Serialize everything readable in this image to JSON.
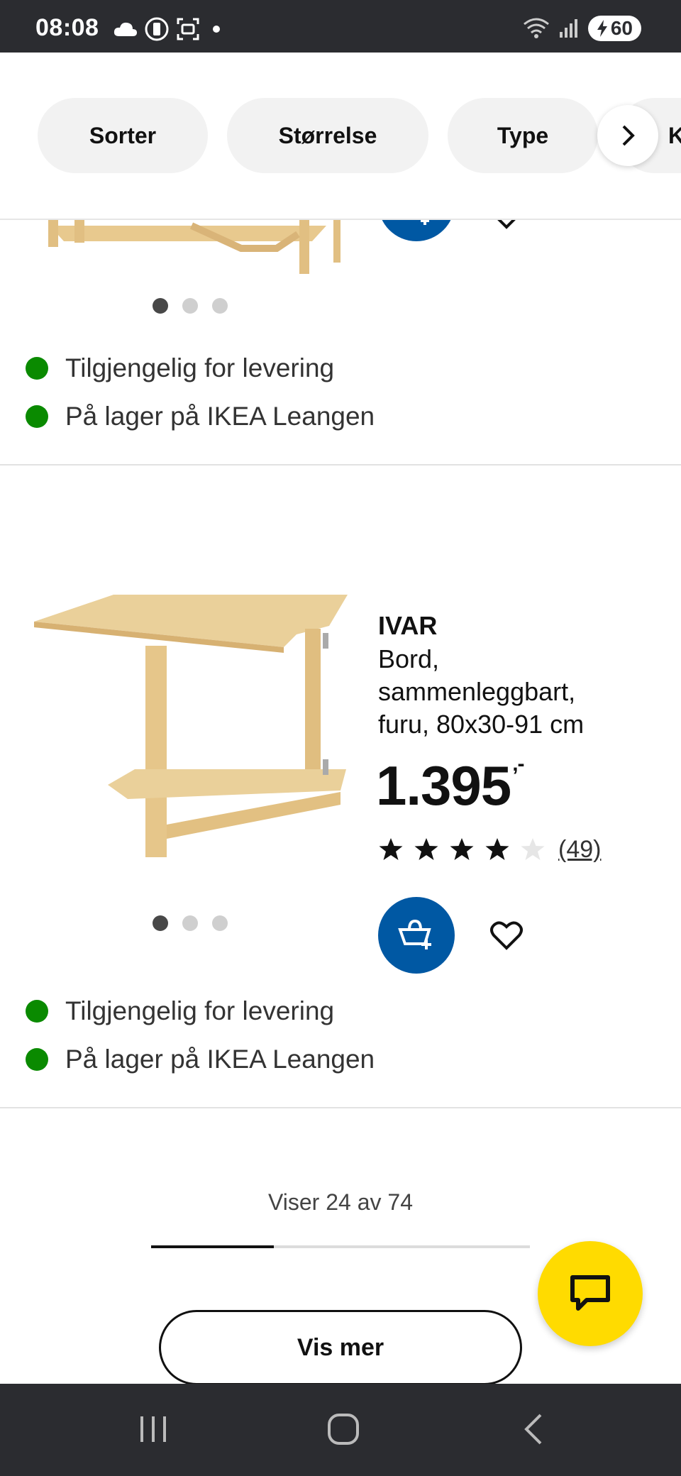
{
  "status_bar": {
    "time": "08:08",
    "battery": "60"
  },
  "filters": [
    {
      "label": "Sorter"
    },
    {
      "label": "Størrelse"
    },
    {
      "label": "Type"
    },
    {
      "label": "K"
    }
  ],
  "products": [
    {
      "availability": [
        "Tilgjengelig for levering",
        "På lager på IKEA Leangen"
      ]
    },
    {
      "name": "IVAR",
      "description": "Bord, sammenleggbart, furu, 80x30-91 cm",
      "price": "1.395",
      "price_suffix": ",-",
      "rating": 4,
      "rating_max": 5,
      "review_count": "(49)",
      "availability": [
        "Tilgjengelig for levering",
        "På lager på IKEA Leangen"
      ]
    }
  ],
  "pagination": {
    "text": "Viser 24 av 74",
    "progress_fraction": 0.324,
    "button_label": "Vis mer"
  },
  "colors": {
    "ikea_blue": "#0058a3",
    "chat_yellow": "#ffdb00",
    "in_stock_green": "#0a8a00"
  }
}
